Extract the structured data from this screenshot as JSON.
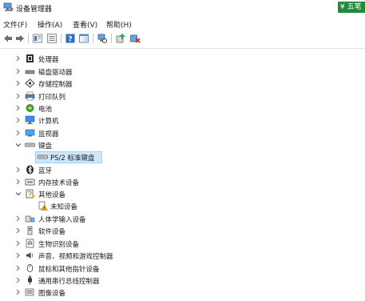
{
  "window": {
    "title": "设备管理器"
  },
  "ime": {
    "label": "五笔"
  },
  "menubar": {
    "file": "文件(F)",
    "action": "操作(A)",
    "view": "查看(V)",
    "help": "帮助(H)"
  },
  "tree": {
    "processor": "处理器",
    "disk_drives": "磁盘驱动器",
    "storage_controllers": "存储控制器",
    "print_queues": "打印队列",
    "battery": "电池",
    "computer": "计算机",
    "monitors": "监视器",
    "keyboards": "键盘",
    "ps2_keyboard": "PS/2 标准键盘",
    "bluetooth": "蓝牙",
    "memory_tech": "内存技术设备",
    "other_devices": "其他设备",
    "unknown_device": "未知设备",
    "hid": "人体学输入设备",
    "software_devices": "软件设备",
    "biometric": "生物识别设备",
    "sound": "声音、视频和游戏控制器",
    "mice": "鼠标和其他指针设备",
    "usb": "通用串行总线控制器",
    "imaging": "图像设备"
  },
  "colors": {
    "selection": "#cce8ff",
    "selection_border": "#99d1ff",
    "ime_green": "#1f8a3b",
    "warning": "#f5b400"
  },
  "icons": {
    "processor": "chip-icon",
    "disk_drives": "disk-icon",
    "storage_controllers": "storage-controller-icon",
    "print_queues": "printer-icon",
    "battery": "battery-icon",
    "computer": "computer-icon",
    "monitors": "monitor-icon",
    "keyboards": "keyboard-icon",
    "bluetooth": "bluetooth-icon",
    "memory_tech": "memory-icon",
    "other_devices": "other-devices-icon",
    "unknown_device": "warning-icon",
    "hid": "hid-icon",
    "software_devices": "software-device-icon",
    "biometric": "fingerprint-icon",
    "sound": "speaker-icon",
    "mice": "mouse-icon",
    "usb": "usb-icon",
    "imaging": "camera-icon"
  }
}
